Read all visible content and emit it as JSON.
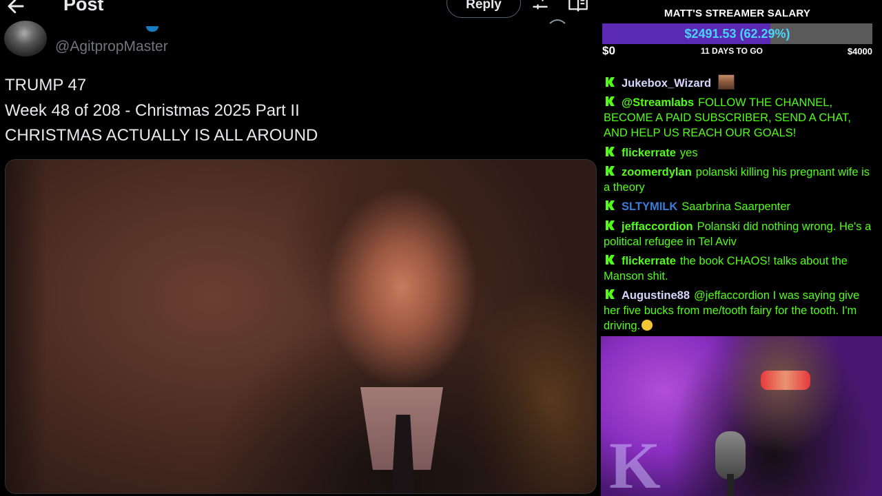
{
  "post": {
    "header": {
      "title": "Post",
      "reply_label": "Reply"
    },
    "author": {
      "handle": "@AgitpropMaster"
    },
    "text_lines": [
      "TRUMP 47",
      "Week 48 of 208 - Christmas 2025 Part II",
      "CHRISTMAS ACTUALLY IS ALL AROUND"
    ]
  },
  "salary_widget": {
    "title": "MATT'S STREAMER SALARY",
    "amount_label": "$2491.53 (62.29%)",
    "progress_percent": 62.29,
    "min_label": "$0",
    "days_label": "11 DAYS TO GO",
    "max_label": "$4000",
    "fill_color": "#5b2ab5",
    "amount_color": "#4ad3ff"
  },
  "chat": {
    "name_color_default": "#53fc18",
    "messages": [
      {
        "user": "Jukebox_Wizard",
        "text": "",
        "user_color": "#d6d6ff",
        "text_color": "#53fc18",
        "emote": true
      },
      {
        "user": "@Streamlabs",
        "text": "FOLLOW THE CHANNEL, BECOME A PAID SUBSCRIBER, SEND A CHAT, AND HELP US REACH OUR GOALS!",
        "user_color": "#53fc18",
        "text_color": "#53fc18"
      },
      {
        "user": "flickerrate",
        "text": "yes",
        "user_color": "#53fc18",
        "text_color": "#53fc18"
      },
      {
        "user": "zoomerdylan",
        "text": "polanski killing his pregnant wife is a theory",
        "user_color": "#53fc18",
        "text_color": "#53fc18"
      },
      {
        "user": "SLTYMILK",
        "text": "Saarbrina Saarpenter",
        "user_color": "#3b7dd8",
        "text_color": "#53fc18"
      },
      {
        "user": "jeffaccordion",
        "text": "Polanski did nothing wrong. He's a political refugee in Tel Aviv",
        "user_color": "#53fc18",
        "text_color": "#53fc18"
      },
      {
        "user": "flickerrate",
        "text": "the book CHAOS! talks about the Manson shit.",
        "user_color": "#53fc18",
        "text_color": "#53fc18"
      },
      {
        "user": "Augustine88",
        "text": "@jeffaccordion I was saying give her five bucks from me/tooth fairy for the tooth. I'm driving.",
        "user_color": "#d6d6ff",
        "text_color": "#53fc18",
        "emoji": true
      }
    ]
  }
}
